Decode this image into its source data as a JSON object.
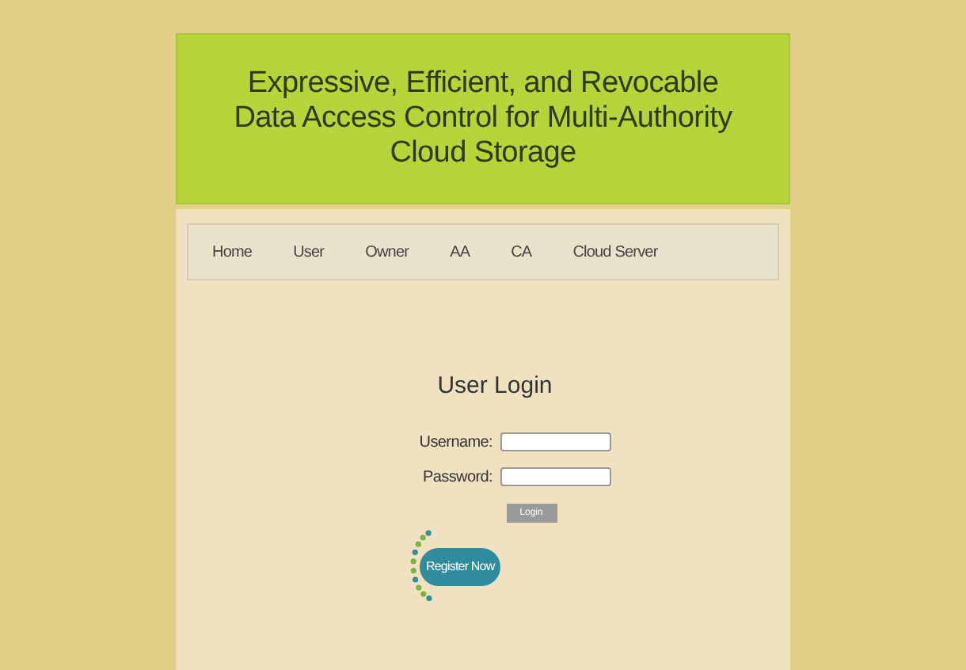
{
  "header": {
    "title": "Expressive, Efficient, and Revocable Data Access Control for Multi-Authority Cloud Storage"
  },
  "nav": [
    "Home",
    "User",
    "Owner",
    "AA",
    "CA",
    "Cloud Server"
  ],
  "login": {
    "title": "User Login",
    "fields": [
      {
        "label": "Username:"
      },
      {
        "label": "Password:"
      }
    ],
    "button": "Login",
    "register": "Register Now"
  }
}
